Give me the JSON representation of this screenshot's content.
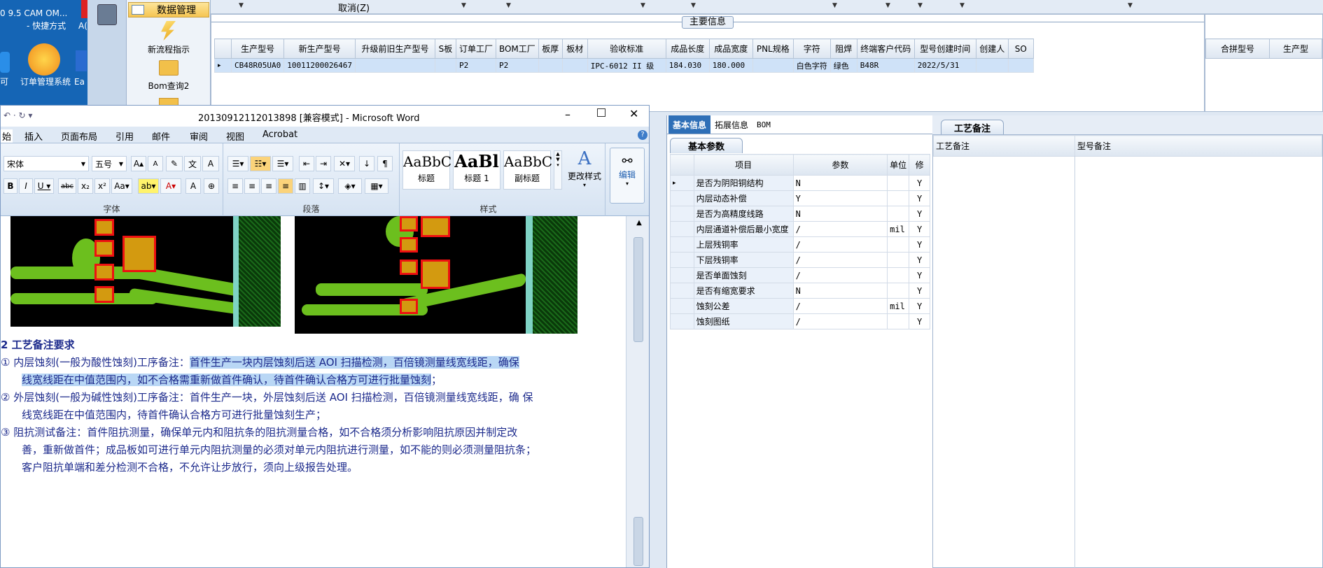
{
  "desktop": {
    "top_label": "0 9.5  CAM OM...",
    "top_label2": "- 快捷方式",
    "top_label3": "A(",
    "order_icon_label": "订单管理系统",
    "order_icon_label_b": "统",
    "left_label": "可",
    "ea_label": "Ea"
  },
  "app": {
    "nav_header": "数据管理",
    "nav_items": [
      "新流程指示",
      "Bom查询2"
    ],
    "top_menu_cancel": "取消(Z)",
    "main_section_title": "主要信息",
    "right_section_title": "合拼型号",
    "right_section_col2": "生产型",
    "main_table": {
      "columns": [
        "生产型号",
        "新生产型号",
        "升级前旧生产型号",
        "S板",
        "订单工厂",
        "BOM工厂",
        "板厚",
        "板材",
        "验收标准",
        "成品长度",
        "成品宽度",
        "PNL规格",
        "字符",
        "阻焊",
        "终端客户代码",
        "型号创建时间",
        "创建人",
        "SO"
      ],
      "rows": [
        [
          "CB48R05UA0",
          "10011200026467",
          "",
          "",
          "P2",
          "P2",
          "",
          "",
          "IPC-6012 II 级",
          "184.030",
          "180.000",
          "",
          "白色字符",
          "绿色",
          "B48R",
          "2022/5/31",
          "",
          ""
        ]
      ]
    }
  },
  "word": {
    "title": "20130912112013898 [兼容模式] - Microsoft Word",
    "tabs": [
      "始",
      "插入",
      "页面布局",
      "引用",
      "邮件",
      "审阅",
      "视图",
      "Acrobat"
    ],
    "font_name": "宋体",
    "font_size": "五号",
    "group_font": "字体",
    "group_paragraph": "段落",
    "group_styles": "样式",
    "styles": [
      {
        "preview": "AaBbC",
        "name": "标题"
      },
      {
        "preview": "AaBl",
        "name": "标题 1"
      },
      {
        "preview": "AaBbC",
        "name": "副标题"
      }
    ],
    "change_styles": "更改样式",
    "edit": "编辑",
    "doc": {
      "heading": "2 工艺备注要求",
      "p1_prefix": "①   内层蚀刻(一般为酸性蚀刻)工序备注：",
      "p1_highlight": "首件生产一块内层蚀刻后送 AOI 扫描检测，百倍镜测量线宽线距，确保",
      "p1_line2_highlight": "线宽线距在中值范围内，如不合格需重新做首件确认，待首件确认合格方可进行批量蚀刻",
      "p1_line2_rest": "；",
      "p2_line1": "②   外层蚀刻(一般为碱性蚀刻)工序备注：首件生产一块，外层蚀刻后送 AOI 扫描检测，百倍镜测量线宽线距，确  保",
      "p2_line2": "线宽线距在中值范围内，待首件确认合格方可进行批量蚀刻生产；",
      "p3_line1": "③   阻抗测试备注：首件阻抗测量，确保单元内和阻抗条的阻抗测量合格，如不合格须分析影响阻抗原因并制定改",
      "p3_line2": "善，重新做首件；成品板如可进行单元内阻抗测量的必须对单元内阻抗进行测量，如不能的则必须测量阻抗条；",
      "p3_line3": "客户阻抗单端和差分检测不合格，不允许让步放行，须向上级报告处理。"
    }
  },
  "detail": {
    "tabs": [
      "基本信息",
      "拓展信息",
      "BOM"
    ],
    "param_tab": "基本参数",
    "process_tab": "工艺备注",
    "param_columns": [
      "项目",
      "参数",
      "单位",
      "修"
    ],
    "params": [
      [
        "是否为阴阳铜结构",
        "N",
        "",
        "Y"
      ],
      [
        "内层动态补偿",
        "Y",
        "",
        "Y"
      ],
      [
        "是否为高精度线路",
        "N",
        "",
        "Y"
      ],
      [
        "内层通道补偿后最小宽度",
        "/",
        "mil",
        "Y"
      ],
      [
        "上层残铜率",
        "/",
        "",
        "Y"
      ],
      [
        "下层残铜率",
        "/",
        "",
        "Y"
      ],
      [
        "是否单面蚀刻",
        "/",
        "",
        "Y"
      ],
      [
        "是否有缩宽要求",
        "N",
        "",
        "Y"
      ],
      [
        "蚀刻公差",
        "/",
        "mil",
        "Y"
      ],
      [
        "蚀刻图纸",
        "/",
        "",
        "Y"
      ]
    ],
    "process_columns": [
      "工艺备注",
      "型号备注"
    ]
  }
}
